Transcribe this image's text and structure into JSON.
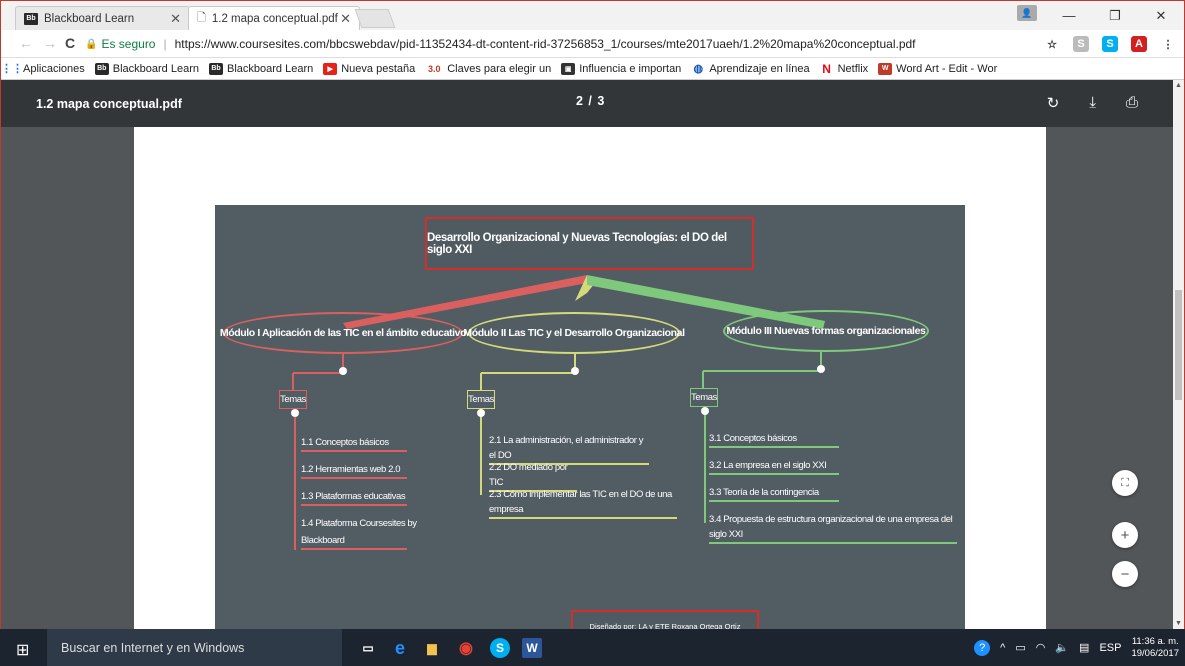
{
  "browser": {
    "tabs": [
      {
        "label": "Blackboard Learn",
        "favicon": "Bb"
      },
      {
        "label": "1.2 mapa conceptual.pdf",
        "favicon": "page-icon"
      }
    ],
    "address": {
      "secure_label": "Es seguro",
      "url": "https://www.coursesites.com/bbcswebdav/pid-11352434-dt-content-rid-37256853_1/courses/mte2017uaeh/1.2%20mapa%20conceptual.pdf"
    },
    "bookmarks": [
      {
        "label": "Aplicaciones",
        "icon": "apps-icon"
      },
      {
        "label": "Blackboard Learn",
        "icon": "Bb"
      },
      {
        "label": "Blackboard Learn",
        "icon": "Bb"
      },
      {
        "label": "Nueva pestaña",
        "icon": "youtube-icon"
      },
      {
        "label": "Claves para elegir un",
        "icon": "3.0"
      },
      {
        "label": "Influencia e importan",
        "icon": "book-icon"
      },
      {
        "label": "Aprendizaje en línea",
        "icon": "globe-icon"
      },
      {
        "label": "Netflix",
        "icon": "N"
      },
      {
        "label": "Word Art - Edit - Wor",
        "icon": "W"
      }
    ]
  },
  "pdf": {
    "title": "1.2 mapa conceptual.pdf",
    "page_indicator": "2 / 3"
  },
  "map": {
    "title": "Desarrollo Organizacional y Nuevas Tecnologías: el DO del siglo XXI",
    "modules": [
      {
        "label": "Módulo I Aplicación de las TIC en el ámbito educativo",
        "topics_label": "Temas",
        "items": [
          "1.1 Conceptos básicos",
          "1.2 Herramientas web 2.0",
          "1.3 Plataformas educativas",
          "1.4 Plataforma Coursesites by",
          "Blackboard"
        ]
      },
      {
        "label": "Módulo II Las TIC y el Desarrollo Organizacional",
        "topics_label": "Temas",
        "items": [
          "2.1 La administración, el administrador y el DO",
          "2.2 DO mediado por TIC",
          "2.3 Cómo implementar las TIC en el DO de una empresa"
        ]
      },
      {
        "label": "Módulo III Nuevas formas organizacionales",
        "topics_label": "Temas",
        "items": [
          "3.1 Conceptos básicos",
          "3.2 La empresa en el siglo XXI",
          "3.3 Teoría de la contingencia",
          "3.4 Propuesta de estructura organizacional de una empresa del siglo XXI"
        ]
      }
    ],
    "credit": "Diseñado por: LA y ETE Roxana Ortega Ortiz"
  },
  "taskbar": {
    "search_placeholder": "Buscar en Internet y en Windows",
    "language": "ESP",
    "time": "11:36 a. m.",
    "date": "19/06/2017"
  }
}
